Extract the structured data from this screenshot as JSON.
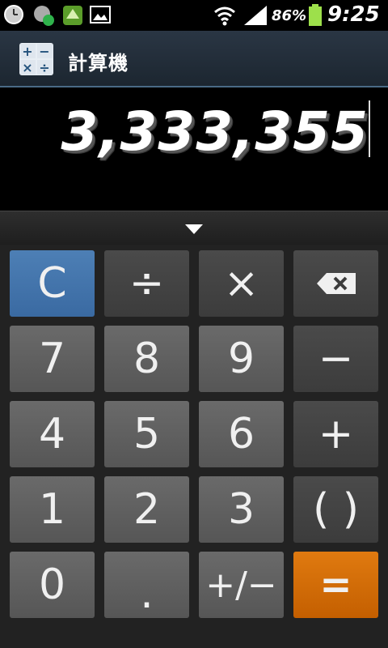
{
  "status_bar": {
    "battery_percent": "86%",
    "time": "9:25"
  },
  "app": {
    "title": "計算機"
  },
  "display": {
    "value": "3,333,355"
  },
  "keys": {
    "clear": "C",
    "divide": "÷",
    "multiply": "×",
    "backspace": "⌫",
    "seven": "7",
    "eight": "8",
    "nine": "9",
    "minus": "−",
    "four": "4",
    "five": "5",
    "six": "6",
    "plus": "+",
    "one": "1",
    "two": "2",
    "three": "3",
    "parens": "( )",
    "zero": "0",
    "dot": ".",
    "plus_minus": "+/−",
    "equals": "="
  },
  "colors": {
    "clear_key": "#3f6fa8",
    "equals_key": "#d86c00"
  }
}
